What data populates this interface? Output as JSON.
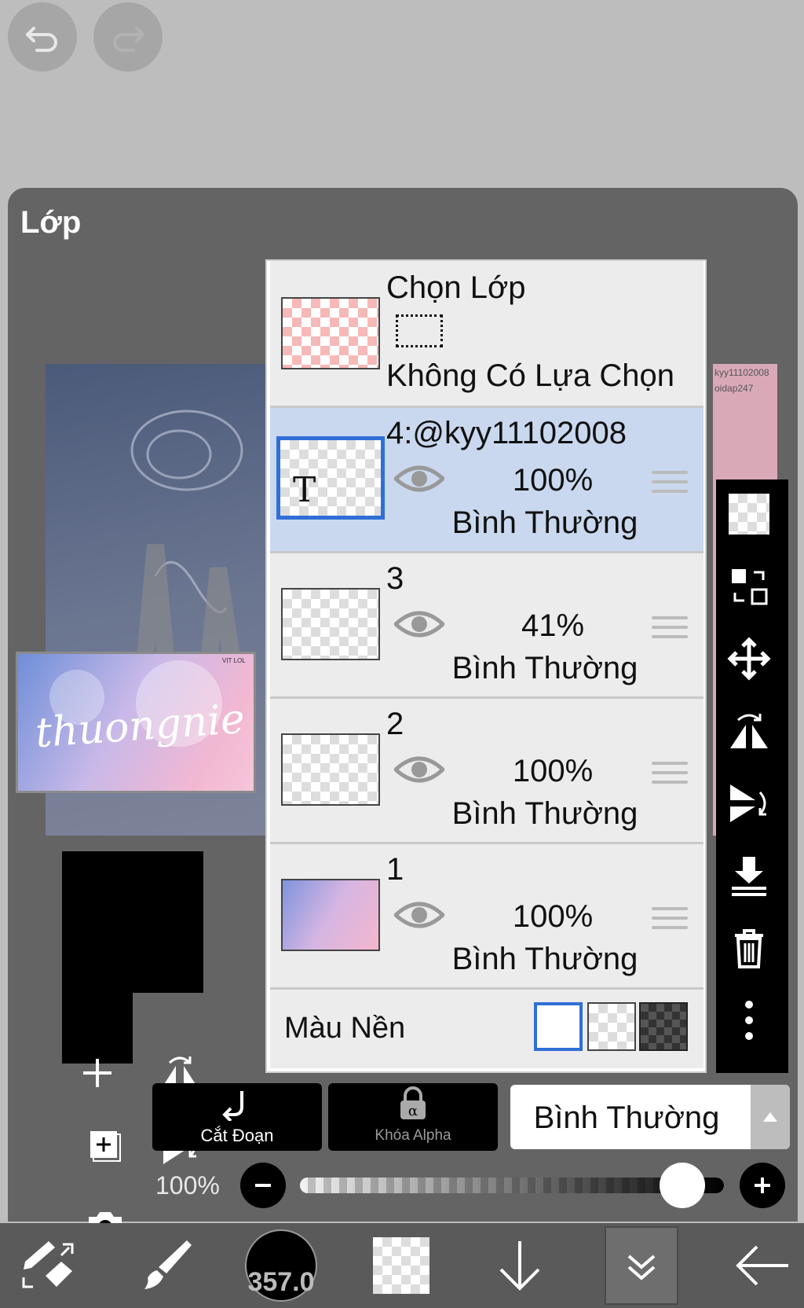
{
  "panel": {
    "title": "Lớp"
  },
  "selection": {
    "title": "Chọn Lớp",
    "status": "Không Có Lựa Chọn"
  },
  "layers": [
    {
      "name": "4:@kyy11102008",
      "opacity": "100%",
      "blend": "Bình Thường",
      "selected": true
    },
    {
      "name": "3",
      "opacity": "41%",
      "blend": "Bình Thường",
      "selected": false
    },
    {
      "name": "2",
      "opacity": "100%",
      "blend": "Bình Thường",
      "selected": false
    },
    {
      "name": "1",
      "opacity": "100%",
      "blend": "Bình Thường",
      "selected": false
    }
  ],
  "background": {
    "label": "Màu Nền"
  },
  "canvas_preview": {
    "text_main": "thuongnie",
    "watermark_1": "kyy11102008",
    "watermark_2": "oidap247",
    "thumb_small": "VỊT LOL"
  },
  "layer_thumb_text": "T",
  "bottom_controls": {
    "clip_label": "Cắt Đoạn",
    "alpha_lock_label": "Khóa Alpha",
    "blend_mode": "Bình Thường",
    "opacity_value": "100%"
  },
  "opacity_slider": {
    "value": 1.0
  },
  "toolbar": {
    "brush_size": "357.0"
  },
  "icons": [
    "undo-icon",
    "redo-icon",
    "checker-icon",
    "swap-layer-icon",
    "move-icon",
    "flip-horizontal-icon",
    "flip-vertical-icon",
    "merge-down-icon",
    "trash-icon",
    "more-icon",
    "add-layer-icon",
    "add-copy-icon",
    "camera-icon",
    "clip-icon",
    "alpha-lock-icon",
    "transform-tool-icon",
    "brush-icon",
    "color-swatch-icon",
    "arrow-down-icon",
    "double-chevron-icon",
    "back-arrow-icon"
  ],
  "colors": {
    "panel_bg": "#646464",
    "selected_row": "#c9d8ee",
    "selected_border": "#2f6fd6",
    "app_bg": "#bdbdbd"
  }
}
